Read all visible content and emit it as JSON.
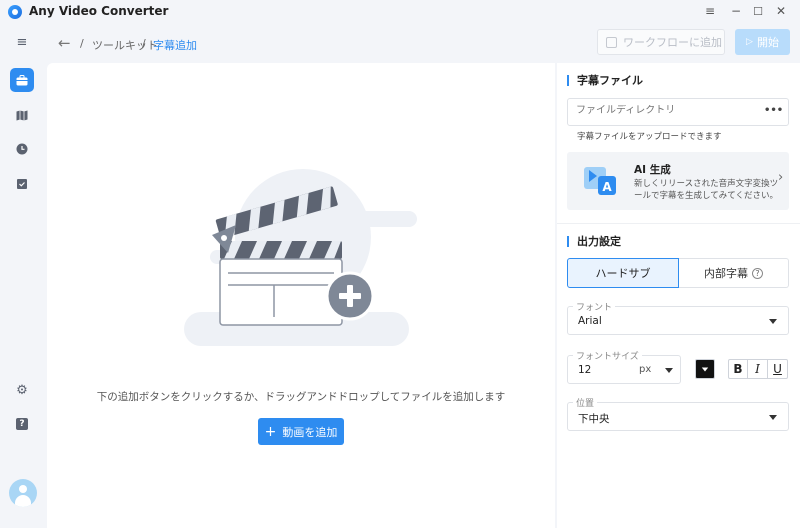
{
  "app": {
    "title": "Any Video Converter"
  },
  "window": {
    "pin_icon": "≡",
    "minimize_icon": "−",
    "maximize_icon": "☐",
    "close_icon": "✕"
  },
  "breadcrumb": {
    "separator": "/",
    "parent": "ツールキット",
    "current": "字幕追加"
  },
  "toolbar": {
    "workflow_label": "ワークフローに追加",
    "start_label": "開始"
  },
  "sidebar": {
    "items": [
      {
        "name": "menu-icon",
        "glyph": "≡"
      },
      {
        "name": "toolbox-icon",
        "glyph": "▣"
      },
      {
        "name": "library-icon",
        "glyph": "▥"
      },
      {
        "name": "history-icon",
        "glyph": "◔"
      },
      {
        "name": "tasks-icon",
        "glyph": "☑"
      },
      {
        "name": "settings-icon",
        "glyph": "⚙"
      },
      {
        "name": "help-icon",
        "glyph": "?"
      }
    ]
  },
  "main": {
    "drop_hint": "下の追加ボタンをクリックするか、ドラッグアンドドロップしてファイルを追加します",
    "add_video_label": "動画を追加"
  },
  "subtitle_file": {
    "title": "字幕ファイル",
    "placeholder": "ファイルディレクトリ",
    "more_icon": "•••",
    "hint": "字幕ファイルをアップロードできます"
  },
  "ai_card": {
    "title": "AI 生成",
    "description": "新しくリリースされた音声文字変換ツールで字幕を生成してみてください。",
    "arrow": "›"
  },
  "output": {
    "title": "出力設定",
    "mode_hard": "ハードサブ",
    "mode_soft": "内部字幕",
    "soft_help": "?",
    "font_label": "フォント",
    "font_value": "Arial",
    "font_size_label": "フォントサイズ",
    "font_size_value": "12",
    "font_size_unit": "px",
    "bold": "B",
    "italic": "I",
    "underline": "U",
    "position_label": "位置",
    "position_value": "下中央"
  },
  "colors": {
    "accent": "#2e8cf0",
    "text_color_swatch": "#111111"
  }
}
